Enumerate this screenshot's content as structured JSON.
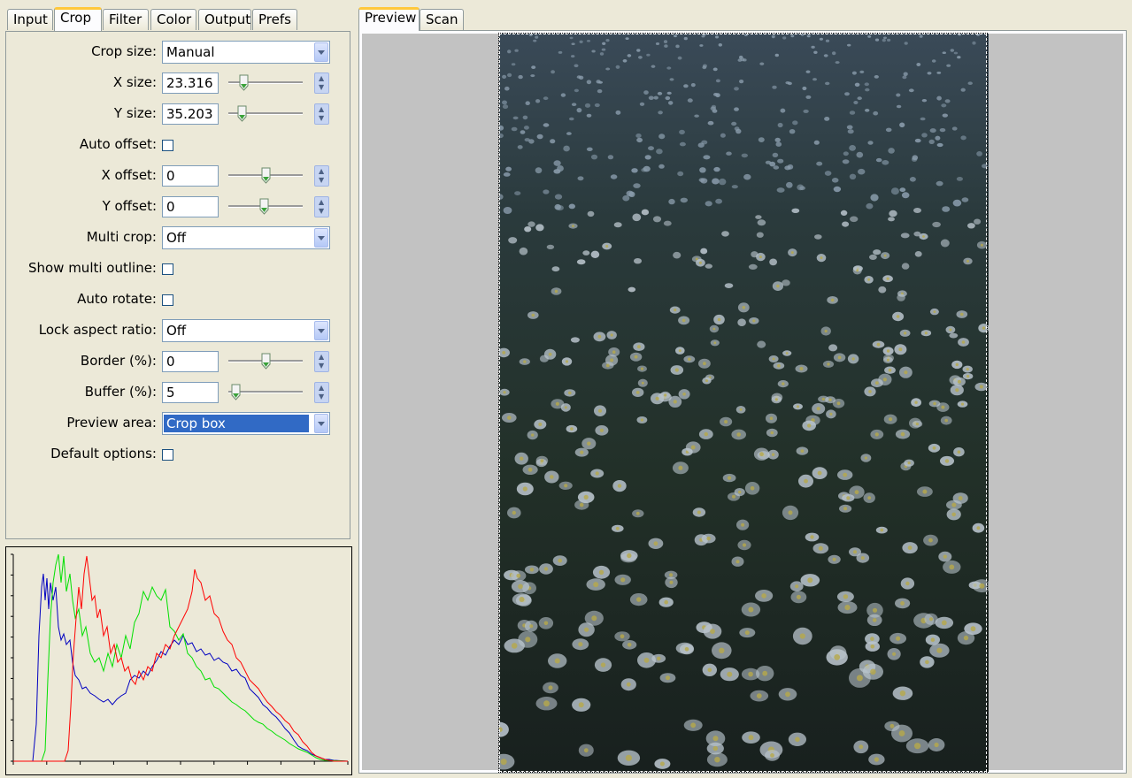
{
  "left_tabs": [
    "Input",
    "Crop",
    "Filter",
    "Color",
    "Output",
    "Prefs"
  ],
  "right_tabs": [
    "Preview",
    "Scan"
  ],
  "crop": {
    "crop_size": {
      "label": "Crop size:",
      "value": "Manual"
    },
    "x_size": {
      "label": "X size:",
      "value": "23.316",
      "slider_fraction": 0.2
    },
    "y_size": {
      "label": "Y size:",
      "value": "35.203",
      "slider_fraction": 0.18
    },
    "auto_offset": {
      "label": "Auto offset:",
      "checked": false
    },
    "x_offset": {
      "label": "X offset:",
      "value": "0",
      "slider_fraction": 0.5
    },
    "y_offset": {
      "label": "Y offset:",
      "value": "0",
      "slider_fraction": 0.48
    },
    "multi_crop": {
      "label": "Multi crop:",
      "value": "Off"
    },
    "show_multi_outline": {
      "label": "Show multi outline:",
      "checked": false
    },
    "auto_rotate": {
      "label": "Auto rotate:",
      "checked": false
    },
    "lock_aspect_ratio": {
      "label": "Lock aspect ratio:",
      "value": "Off"
    },
    "border": {
      "label": "Border (%):",
      "value": "0",
      "slider_fraction": 0.5
    },
    "buffer": {
      "label": "Buffer (%):",
      "value": "5",
      "slider_fraction": 0.1
    },
    "preview_area": {
      "label": "Preview area:",
      "value": "Crop box"
    },
    "default_options": {
      "label": "Default options:",
      "checked": false
    }
  },
  "histogram": {
    "channel_colors": {
      "red": "#ff0000",
      "green": "#00ff00",
      "blue": "#0000c0"
    }
  },
  "colors": {
    "accent_tab": "#ffc83c",
    "selection": "#316ac5"
  }
}
